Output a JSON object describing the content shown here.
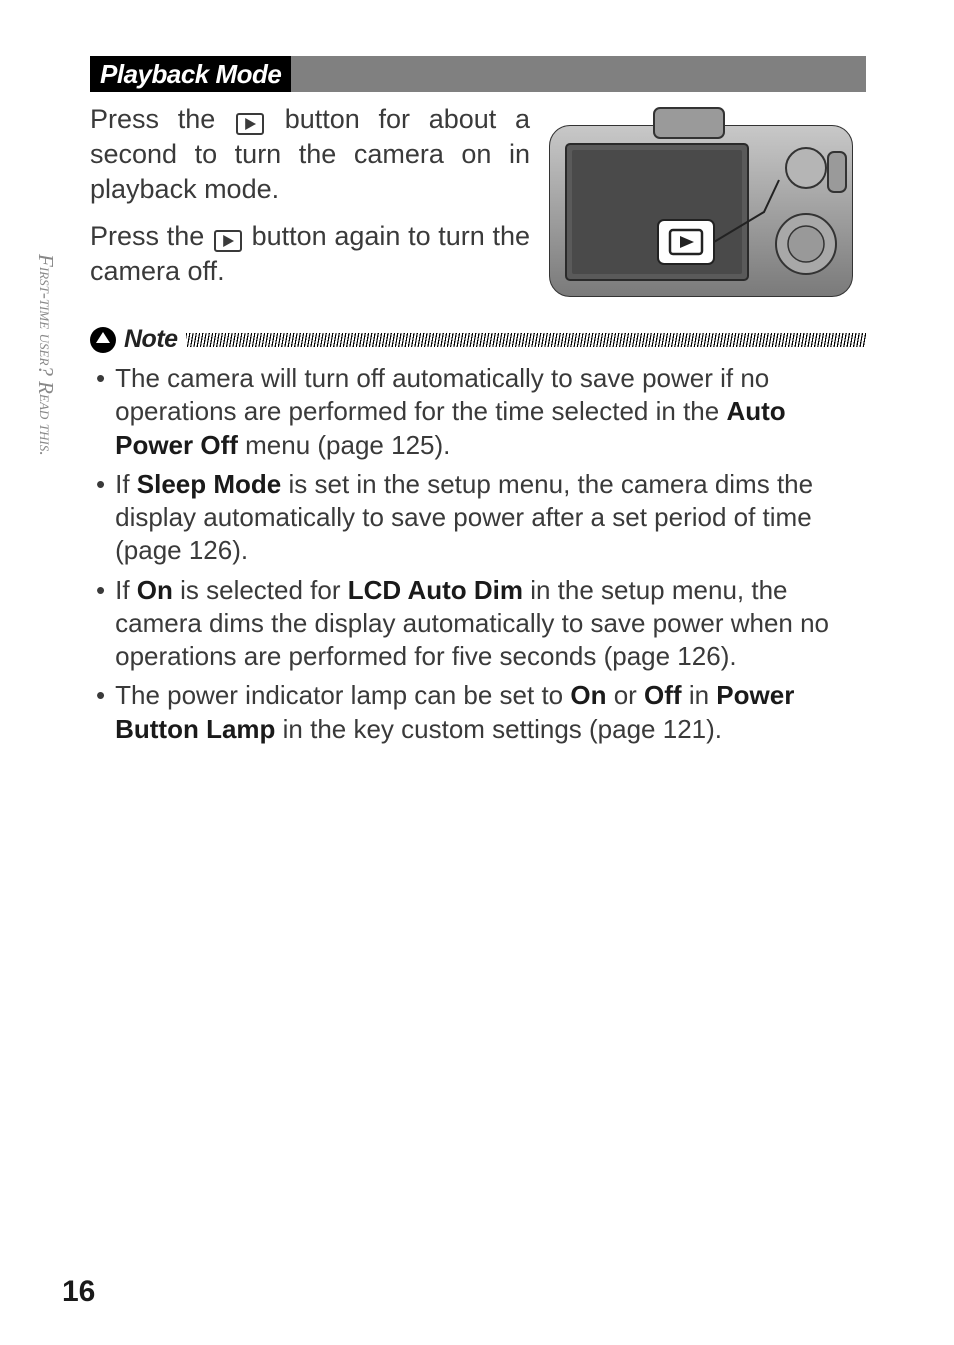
{
  "page_number": "16",
  "sidebar": {
    "part1": "First-time user?",
    "part2": "Read this."
  },
  "section": {
    "heading": "Playback Mode",
    "para1_a": "Press the ",
    "para1_b": " button for about a second to turn the camera on in playback mode.",
    "para2_a": "Press the ",
    "para2_b": " button again to turn the camera off."
  },
  "note": {
    "label": "Note",
    "items": [
      {
        "pre": "The camera will turn off automatically to save power if no operations are performed for the time selected in the ",
        "bold1": "Auto Power Off",
        "post1": " menu (page 125)."
      },
      {
        "pre": "If ",
        "bold1": "Sleep Mode",
        "post1": " is set in the setup menu, the camera dims the display automatically to save power after a set period of time (page 126)."
      },
      {
        "pre": "If ",
        "bold1": "On",
        "mid1": " is selected for ",
        "bold2": "LCD Auto Dim",
        "post1": " in the setup menu, the camera dims the display automatically to save power when no operations are performed for five seconds (page 126)."
      },
      {
        "pre": "The power indicator lamp can be set to ",
        "bold1": "On",
        "mid1": " or ",
        "bold2": "Off",
        "mid2": " in ",
        "bold3": "Power Button Lamp",
        "post1": " in the key custom settings (page 121)."
      }
    ]
  }
}
